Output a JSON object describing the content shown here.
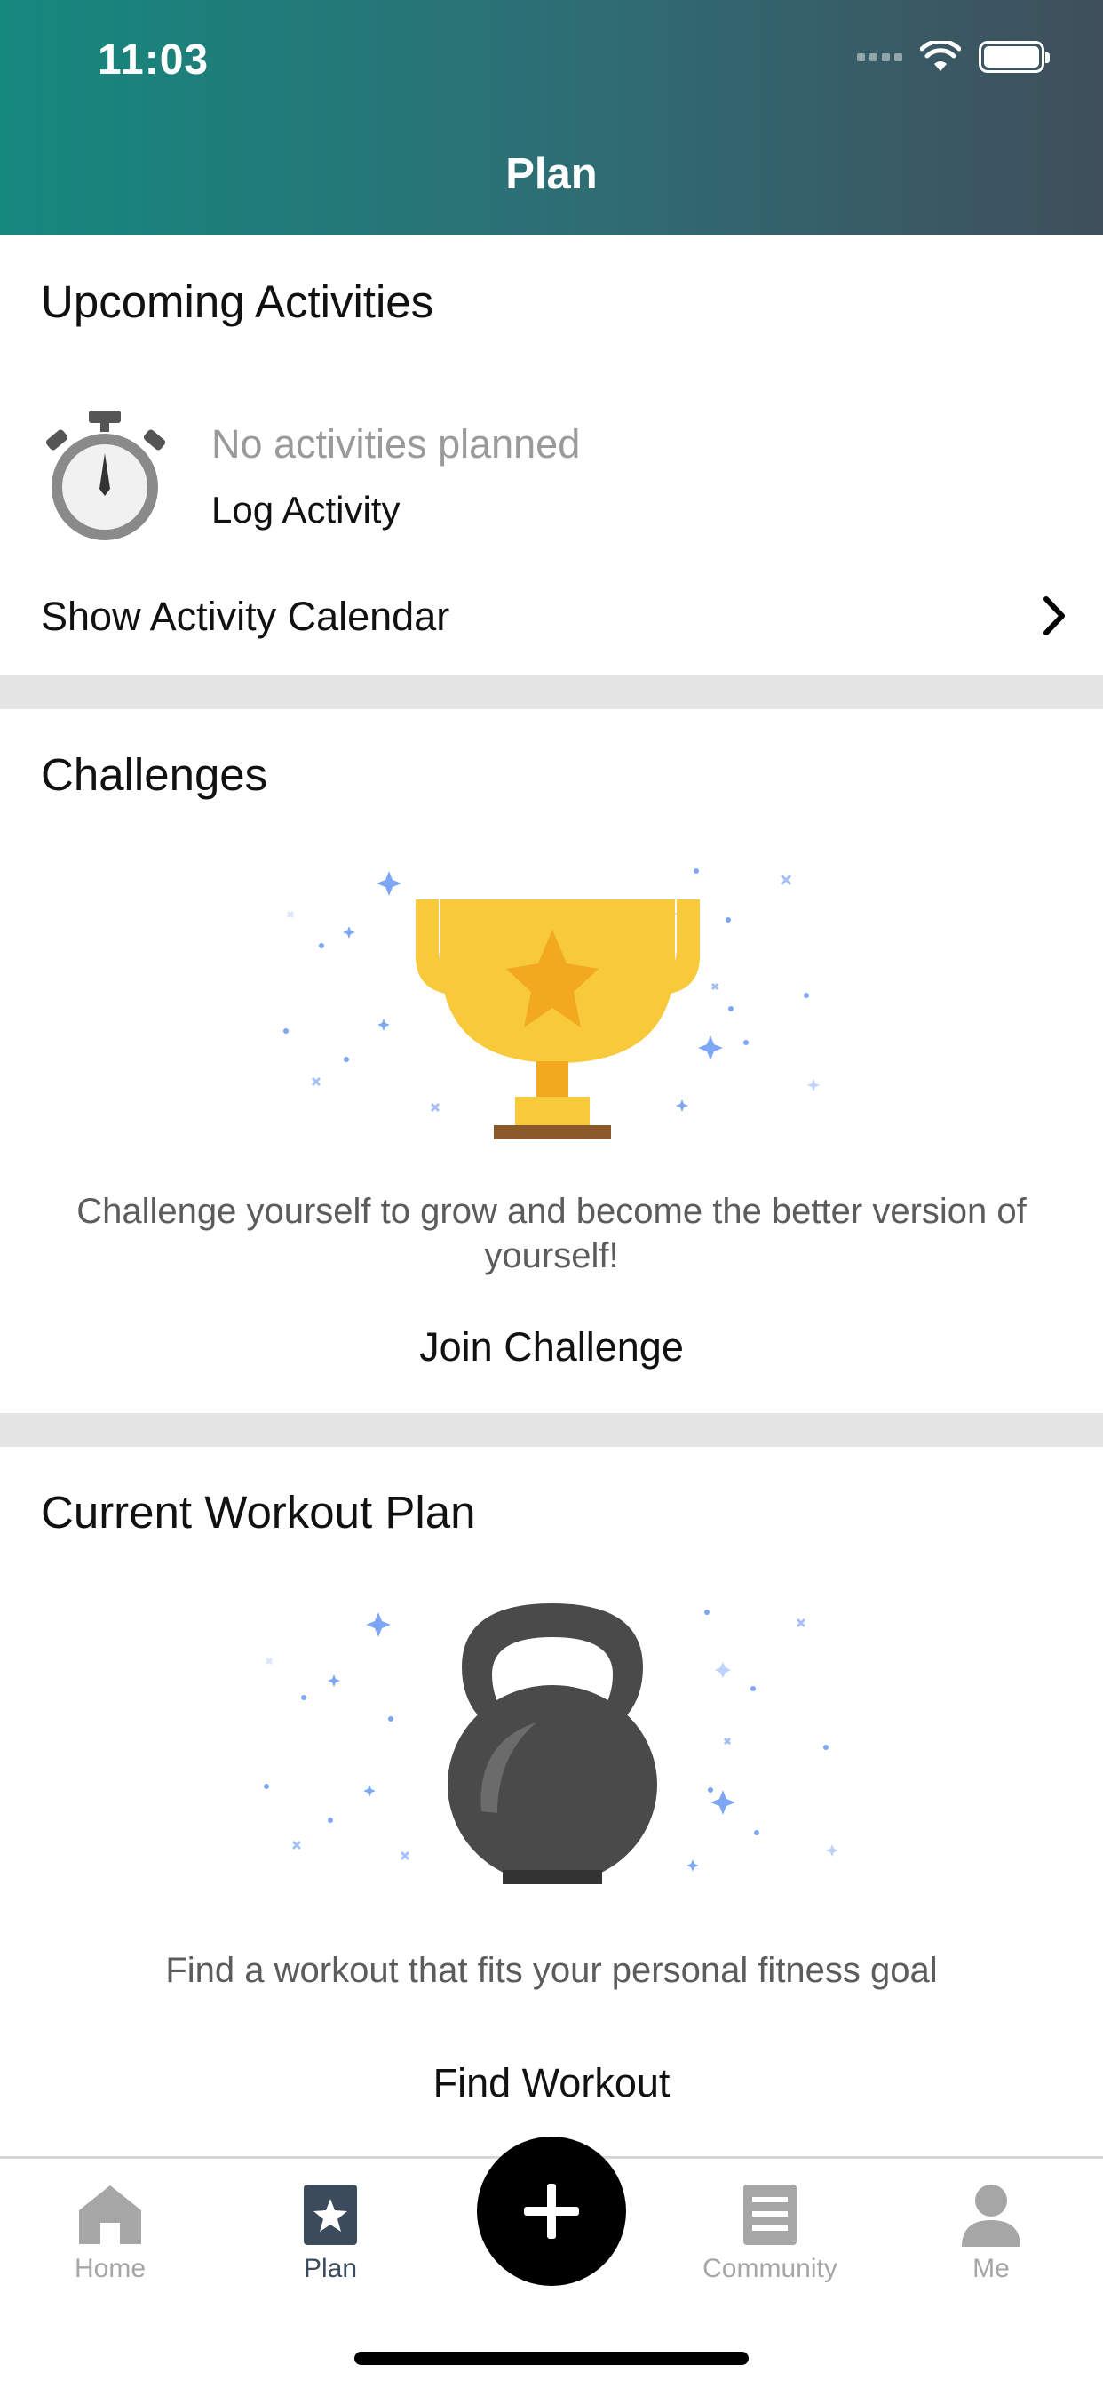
{
  "status_bar": {
    "time": "11:03"
  },
  "header": {
    "title": "Plan"
  },
  "upcoming": {
    "title": "Upcoming Activities",
    "empty_text": "No activities planned",
    "log_label": "Log Activity",
    "calendar_label": "Show Activity Calendar"
  },
  "challenges": {
    "title": "Challenges",
    "description": "Challenge yourself to grow and become the better version of yourself!",
    "action_label": "Join Challenge"
  },
  "workout": {
    "title": "Current Workout Plan",
    "description": "Find a workout that fits your personal fitness goal",
    "action_label": "Find Workout"
  },
  "tabbar": {
    "items": [
      {
        "label": "Home",
        "icon": "home-icon"
      },
      {
        "label": "Plan",
        "icon": "plan-star-icon",
        "active": true
      },
      {
        "label": "Community",
        "icon": "community-icon"
      },
      {
        "label": "Me",
        "icon": "profile-icon"
      }
    ],
    "add_icon": "plus-icon"
  },
  "colors": {
    "header_start": "#15887e",
    "header_end": "#3f4f5b",
    "trophy": "#f8c93a",
    "kettlebell": "#4a4a4a",
    "sparkle": "#7da7f5",
    "tab_active": "#3b4b5c",
    "tab_inactive": "#a6a6a6"
  }
}
